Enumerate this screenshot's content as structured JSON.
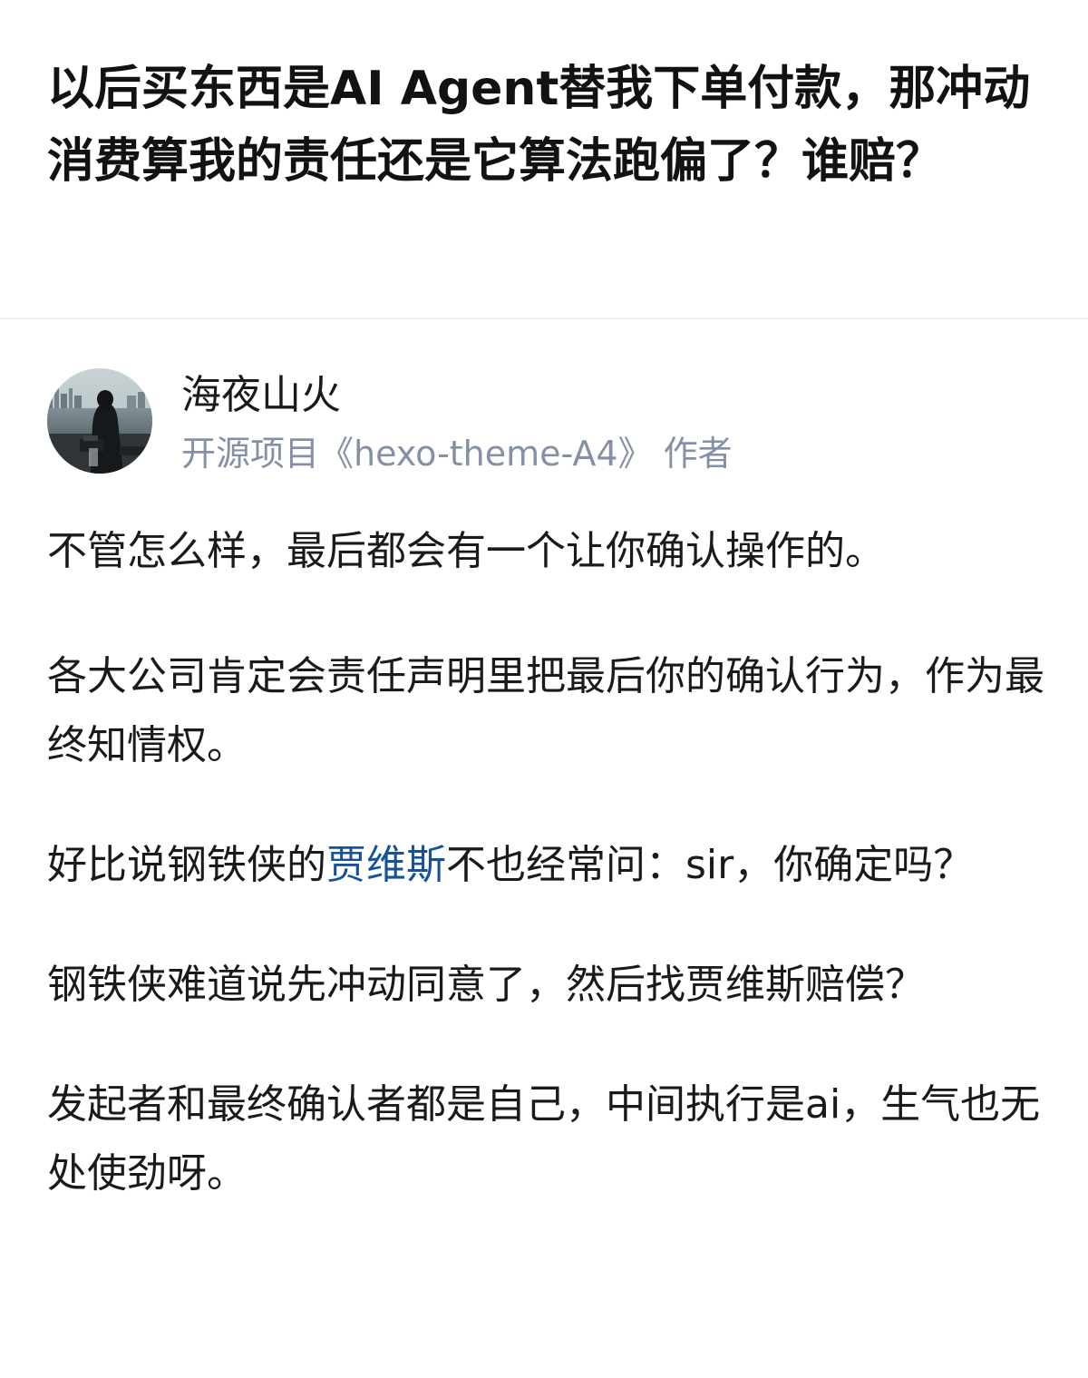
{
  "question": {
    "title": "以后买东西是AI Agent替我下单付款，那冲动消费算我的责任还是它算法跑偏了？谁赔？"
  },
  "author": {
    "name": "海夜山火",
    "headline": "开源项目《hexo-theme-A4》 作者",
    "avatar_icon": "avatar-photo-icon"
  },
  "answer": {
    "paragraphs": [
      {
        "text": "不管怎么样，最后都会有一个让你确认操作的。"
      },
      {
        "text": "各大公司肯定会责任声明里把最后你的确认行为，作为最终知情权。"
      },
      {
        "before": "好比说钢铁侠的",
        "link": "贾维斯",
        "after": "不也经常问：sir，你确定吗？"
      },
      {
        "text": "钢铁侠难道说先冲动同意了，然后找贾维斯赔偿？"
      },
      {
        "text": "发起者和最终确认者都是自己，中间执行是ai，生气也无处使劲呀。"
      }
    ]
  },
  "colors": {
    "title": "#121212",
    "body": "#1a1a1a",
    "meta": "#8590a6",
    "link": "#175199",
    "divider": "#f0f0f0"
  }
}
